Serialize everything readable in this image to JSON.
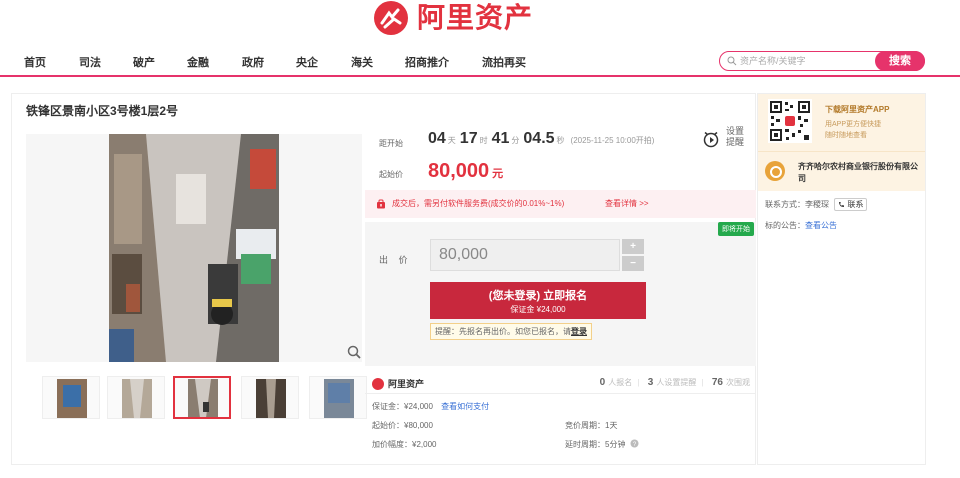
{
  "brand": {
    "name": "阿里资产",
    "color": "#e2323f",
    "logo_icon": "ali-asset-logo-icon"
  },
  "nav": {
    "items": [
      {
        "label": "首页"
      },
      {
        "label": "司法"
      },
      {
        "label": "破产"
      },
      {
        "label": "金融"
      },
      {
        "label": "政府"
      },
      {
        "label": "央企"
      },
      {
        "label": "海关"
      },
      {
        "label": "招商推介"
      },
      {
        "label": "流拍再买"
      }
    ],
    "search_placeholder": "资产名称/关键字",
    "search_button": "搜索",
    "accent_color": "#e6336b"
  },
  "listing": {
    "title": "铁锋区景南小区3号楼1层2号",
    "countdown_label": "距开始",
    "countdown": {
      "days": "04",
      "days_unit": "天",
      "hours": "17",
      "hours_unit": "时",
      "minutes": "41",
      "minutes_unit": "分",
      "seconds": "04.5",
      "seconds_unit": "秒",
      "start_note": "(2025-11-25 10:00开拍)"
    },
    "remind_label": "设置提醒",
    "start_price_label": "起始价",
    "start_price": "80,000",
    "start_price_unit": "元",
    "fee_notice": "成交后，需另付软件服务费(成交价的0.01%~1%)",
    "fee_notice_link": "查看详情 >>",
    "status_tag": "即将开始",
    "bid_label": "出 价",
    "bid_value": "80,000",
    "stepper_plus": "+",
    "stepper_minus": "−",
    "signup_button": "(您未登录) 立即报名",
    "signup_deposit": "保证金 ¥24,000",
    "tip_text": "提醒：先报名再出价。如您已报名，请",
    "tip_login": "登录",
    "stats": {
      "signed_up": "0",
      "signed_up_label": "人报名",
      "reminders": "3",
      "reminders_label": "人设置提醒",
      "views": "76",
      "views_label": "次围观"
    },
    "details": {
      "deposit": "保证金：¥24,000",
      "deposit_link": "查看如何支付",
      "start_price": "起始价：¥80,000",
      "bid_cycle": "竞价周期：1天",
      "increment": "加价幅度：¥2,000",
      "extend_cycle": "延时周期：5分钟"
    }
  },
  "sidebar": {
    "app_title": "下载阿里资产APP",
    "app_sub_line1": "用APP更方便快捷",
    "app_sub_line2": "随时随地查看",
    "bank_name": "齐齐哈尔农村商业银行股份有限公司",
    "contact_label": "联系方式：李稷琛",
    "contact_button": "联系",
    "notice_label": "标的公告：",
    "notice_link": "查看公告"
  }
}
